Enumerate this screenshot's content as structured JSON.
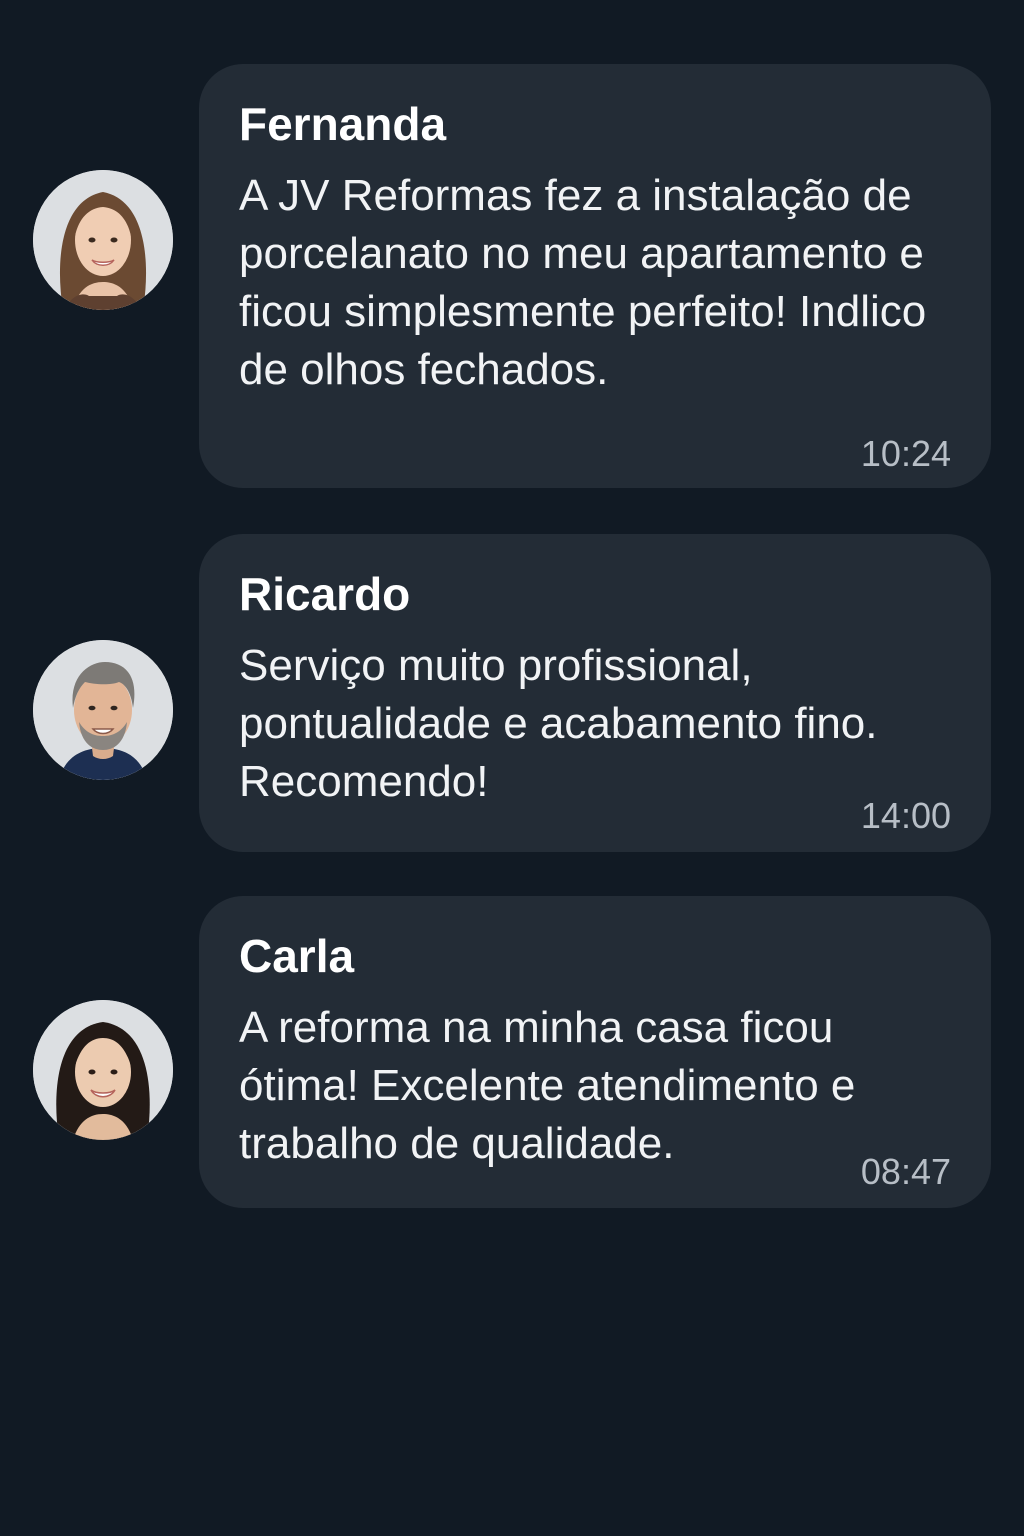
{
  "colors": {
    "background": "#111a24",
    "bubble": "#232c36",
    "sender_text": "#ffffff",
    "message_text": "#f1f3f5",
    "timestamp": "#b7bec6"
  },
  "messages": [
    {
      "sender": "Fernanda",
      "text": "A JV Reformas fez a instalação de porcelanato no meu apartamento e ficou simplesmente perfeito! Indlico de olhos fechados.",
      "time": "10:24",
      "avatar_icon": "woman-avatar-icon"
    },
    {
      "sender": "Ricardo",
      "text": "Serviço muito profissional, pontualidade e acabamento fino. Recomendo!",
      "time": "14:00",
      "avatar_icon": "man-avatar-icon"
    },
    {
      "sender": "Carla",
      "text": "A reforma na minha casa ficou ótima! Excelente atendimento e trabalho de qualidade.",
      "time": "08:47",
      "avatar_icon": "woman-avatar-icon"
    }
  ]
}
